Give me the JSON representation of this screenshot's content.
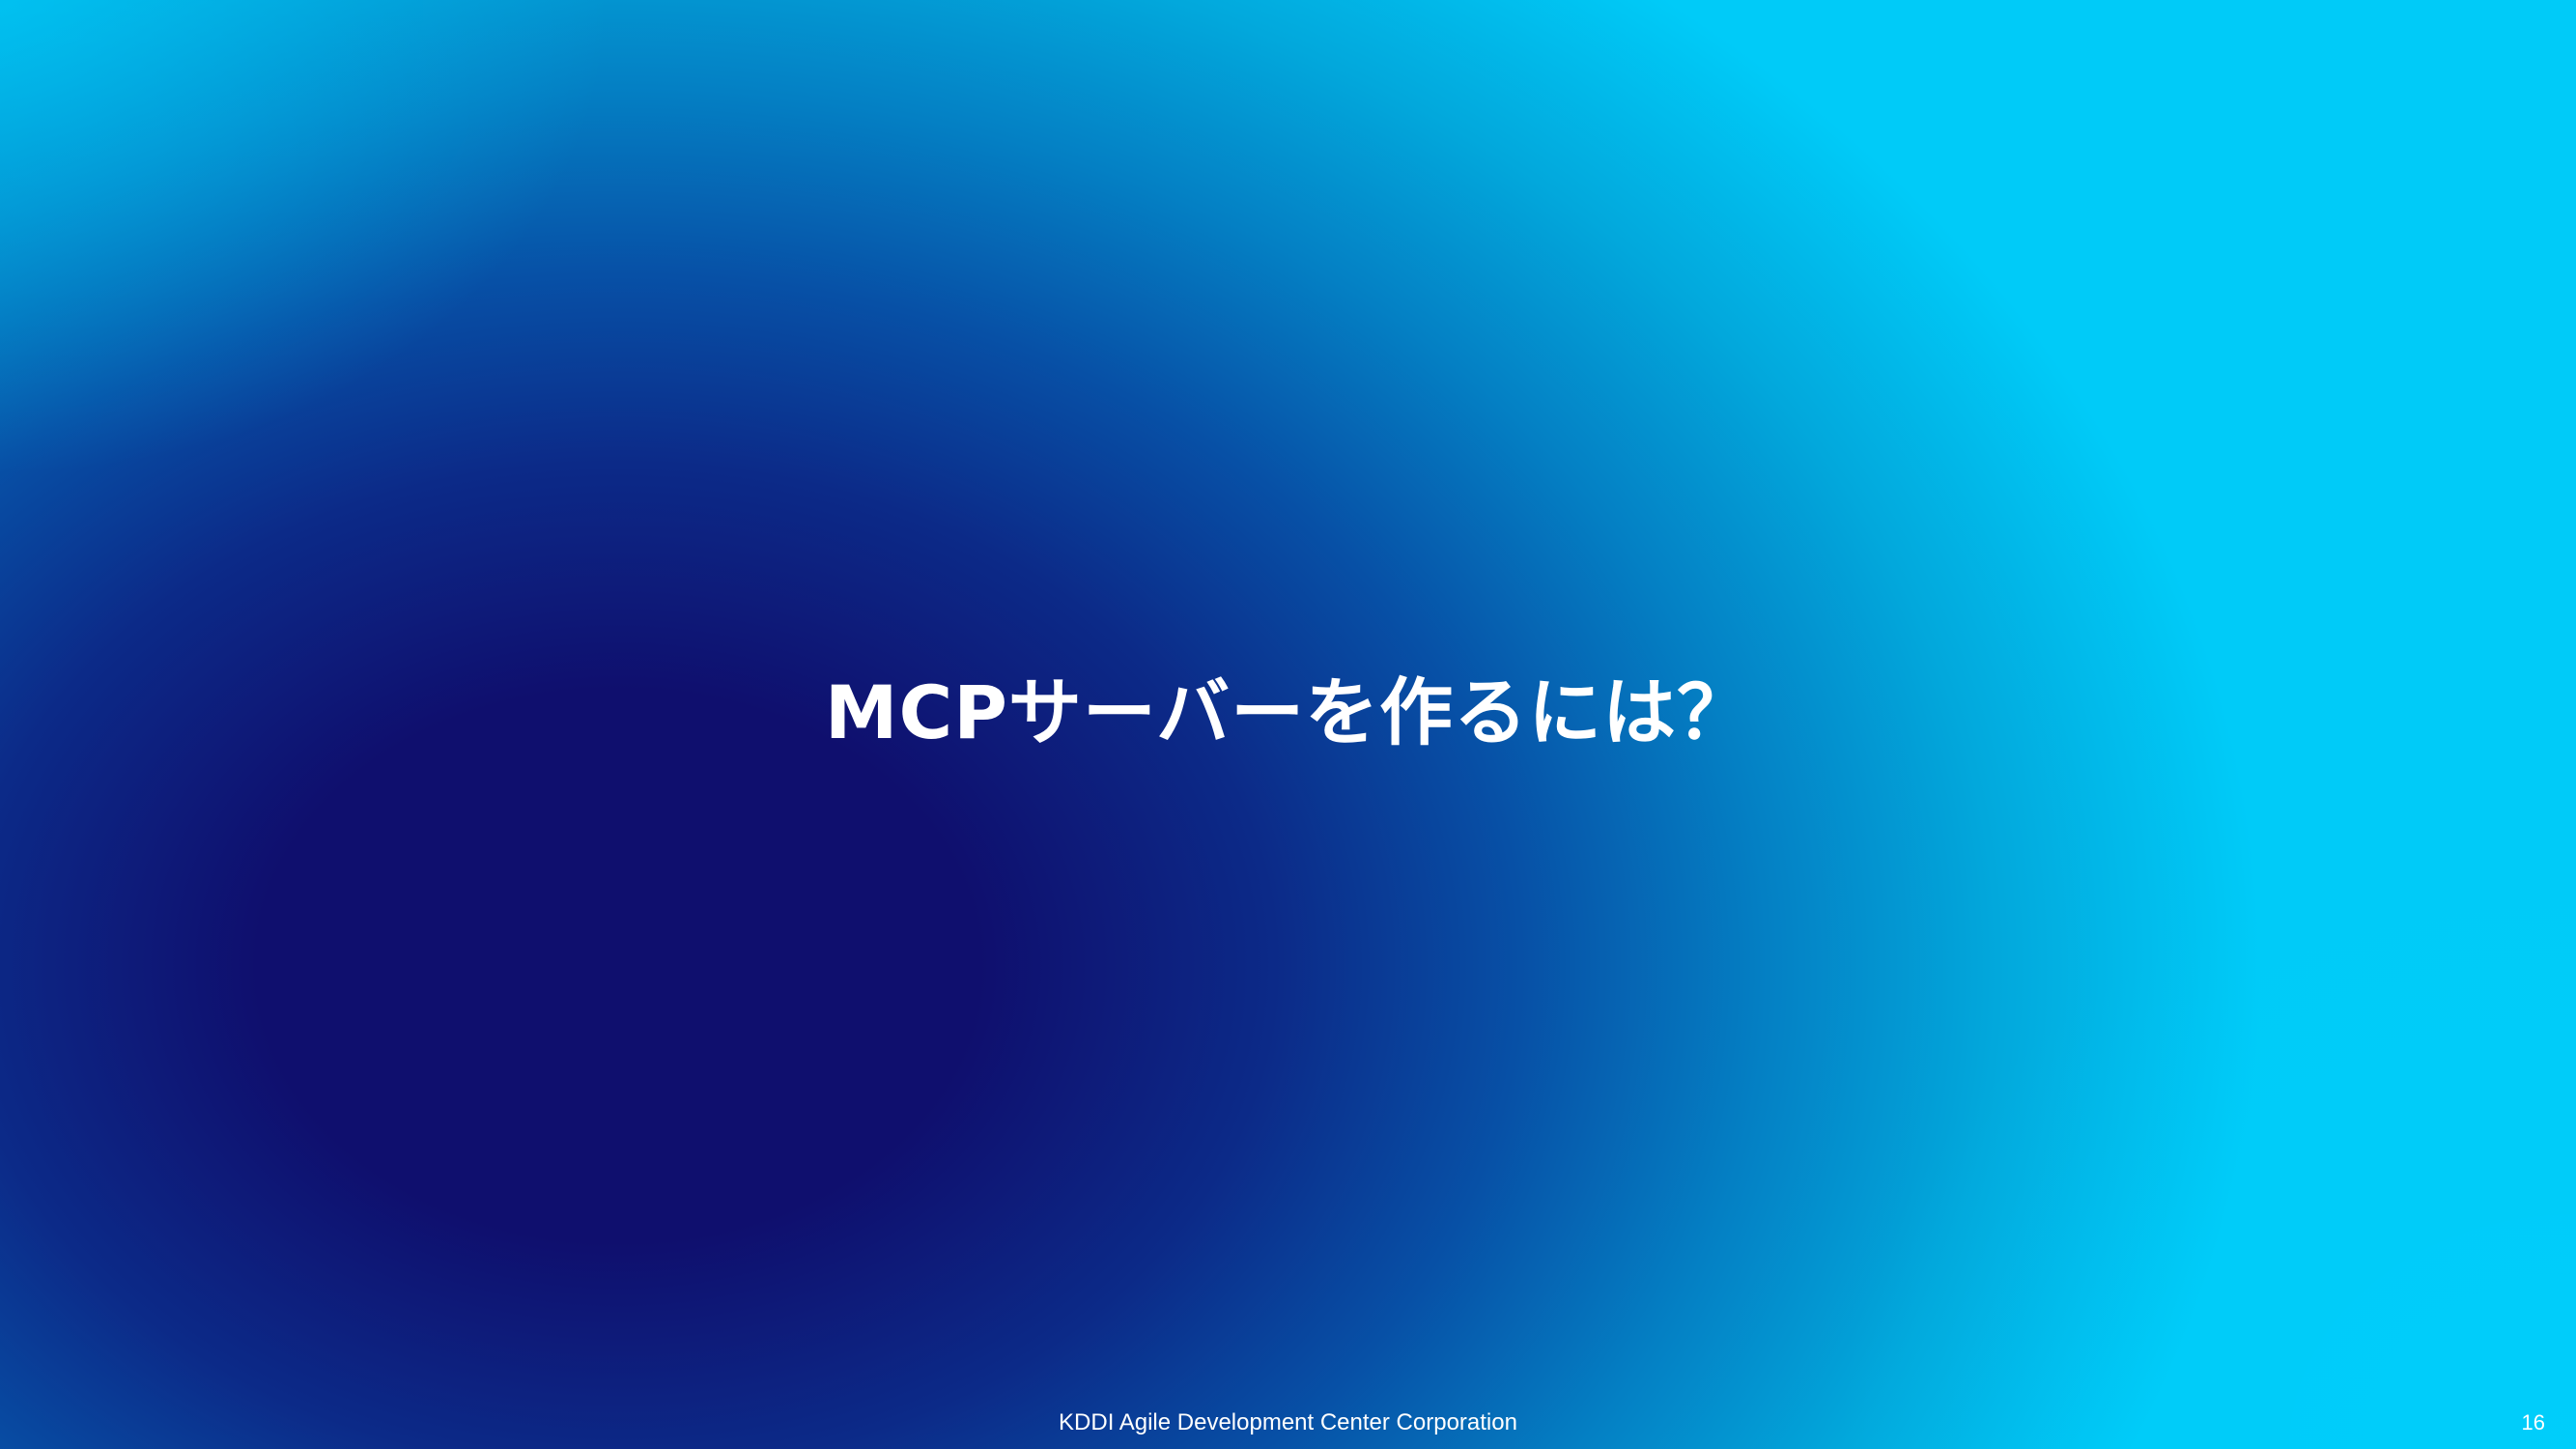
{
  "slide": {
    "title": "MCPサーバーを作るには？",
    "footer": "KDDI Agile Development Center Corporation",
    "page_number": "16"
  },
  "colors": {
    "background_dark": "#0f0f6e",
    "background_light": "#00cbf8",
    "text": "#ffffff"
  }
}
